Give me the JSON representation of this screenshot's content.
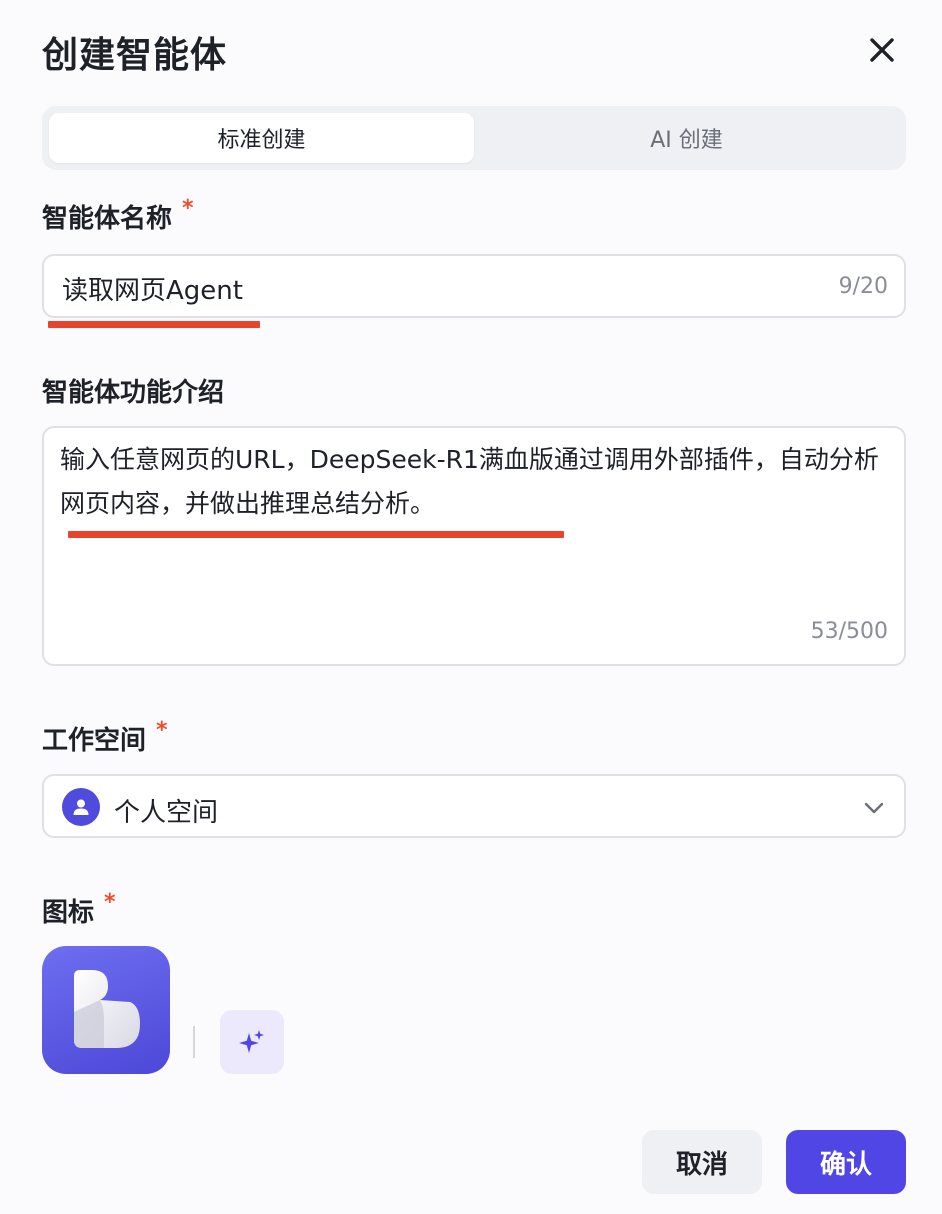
{
  "dialog": {
    "title": "创建智能体"
  },
  "tabs": [
    {
      "label": "标准创建",
      "active": true
    },
    {
      "label": "AI 创建",
      "active": false
    }
  ],
  "name_field": {
    "label": "智能体名称",
    "required_mark": "*",
    "value": "读取网页Agent",
    "counter": "9/20"
  },
  "description_field": {
    "label": "智能体功能介绍",
    "value": "输入任意网页的URL，DeepSeek-R1满血版通过调用外部插件，自动分析网页内容，并做出推理总结分析。",
    "counter": "53/500"
  },
  "workspace_field": {
    "label": "工作空间",
    "required_mark": "*",
    "value": "个人空间",
    "icon": "user-icon"
  },
  "icon_field": {
    "label": "图标",
    "required_mark": "*",
    "generate_icon": "sparkle-icon"
  },
  "footer": {
    "cancel_label": "取消",
    "confirm_label": "确认"
  },
  "colors": {
    "accent": "#4f46e5",
    "required": "#ee4d2d",
    "annotation_underline": "#e8432d"
  }
}
